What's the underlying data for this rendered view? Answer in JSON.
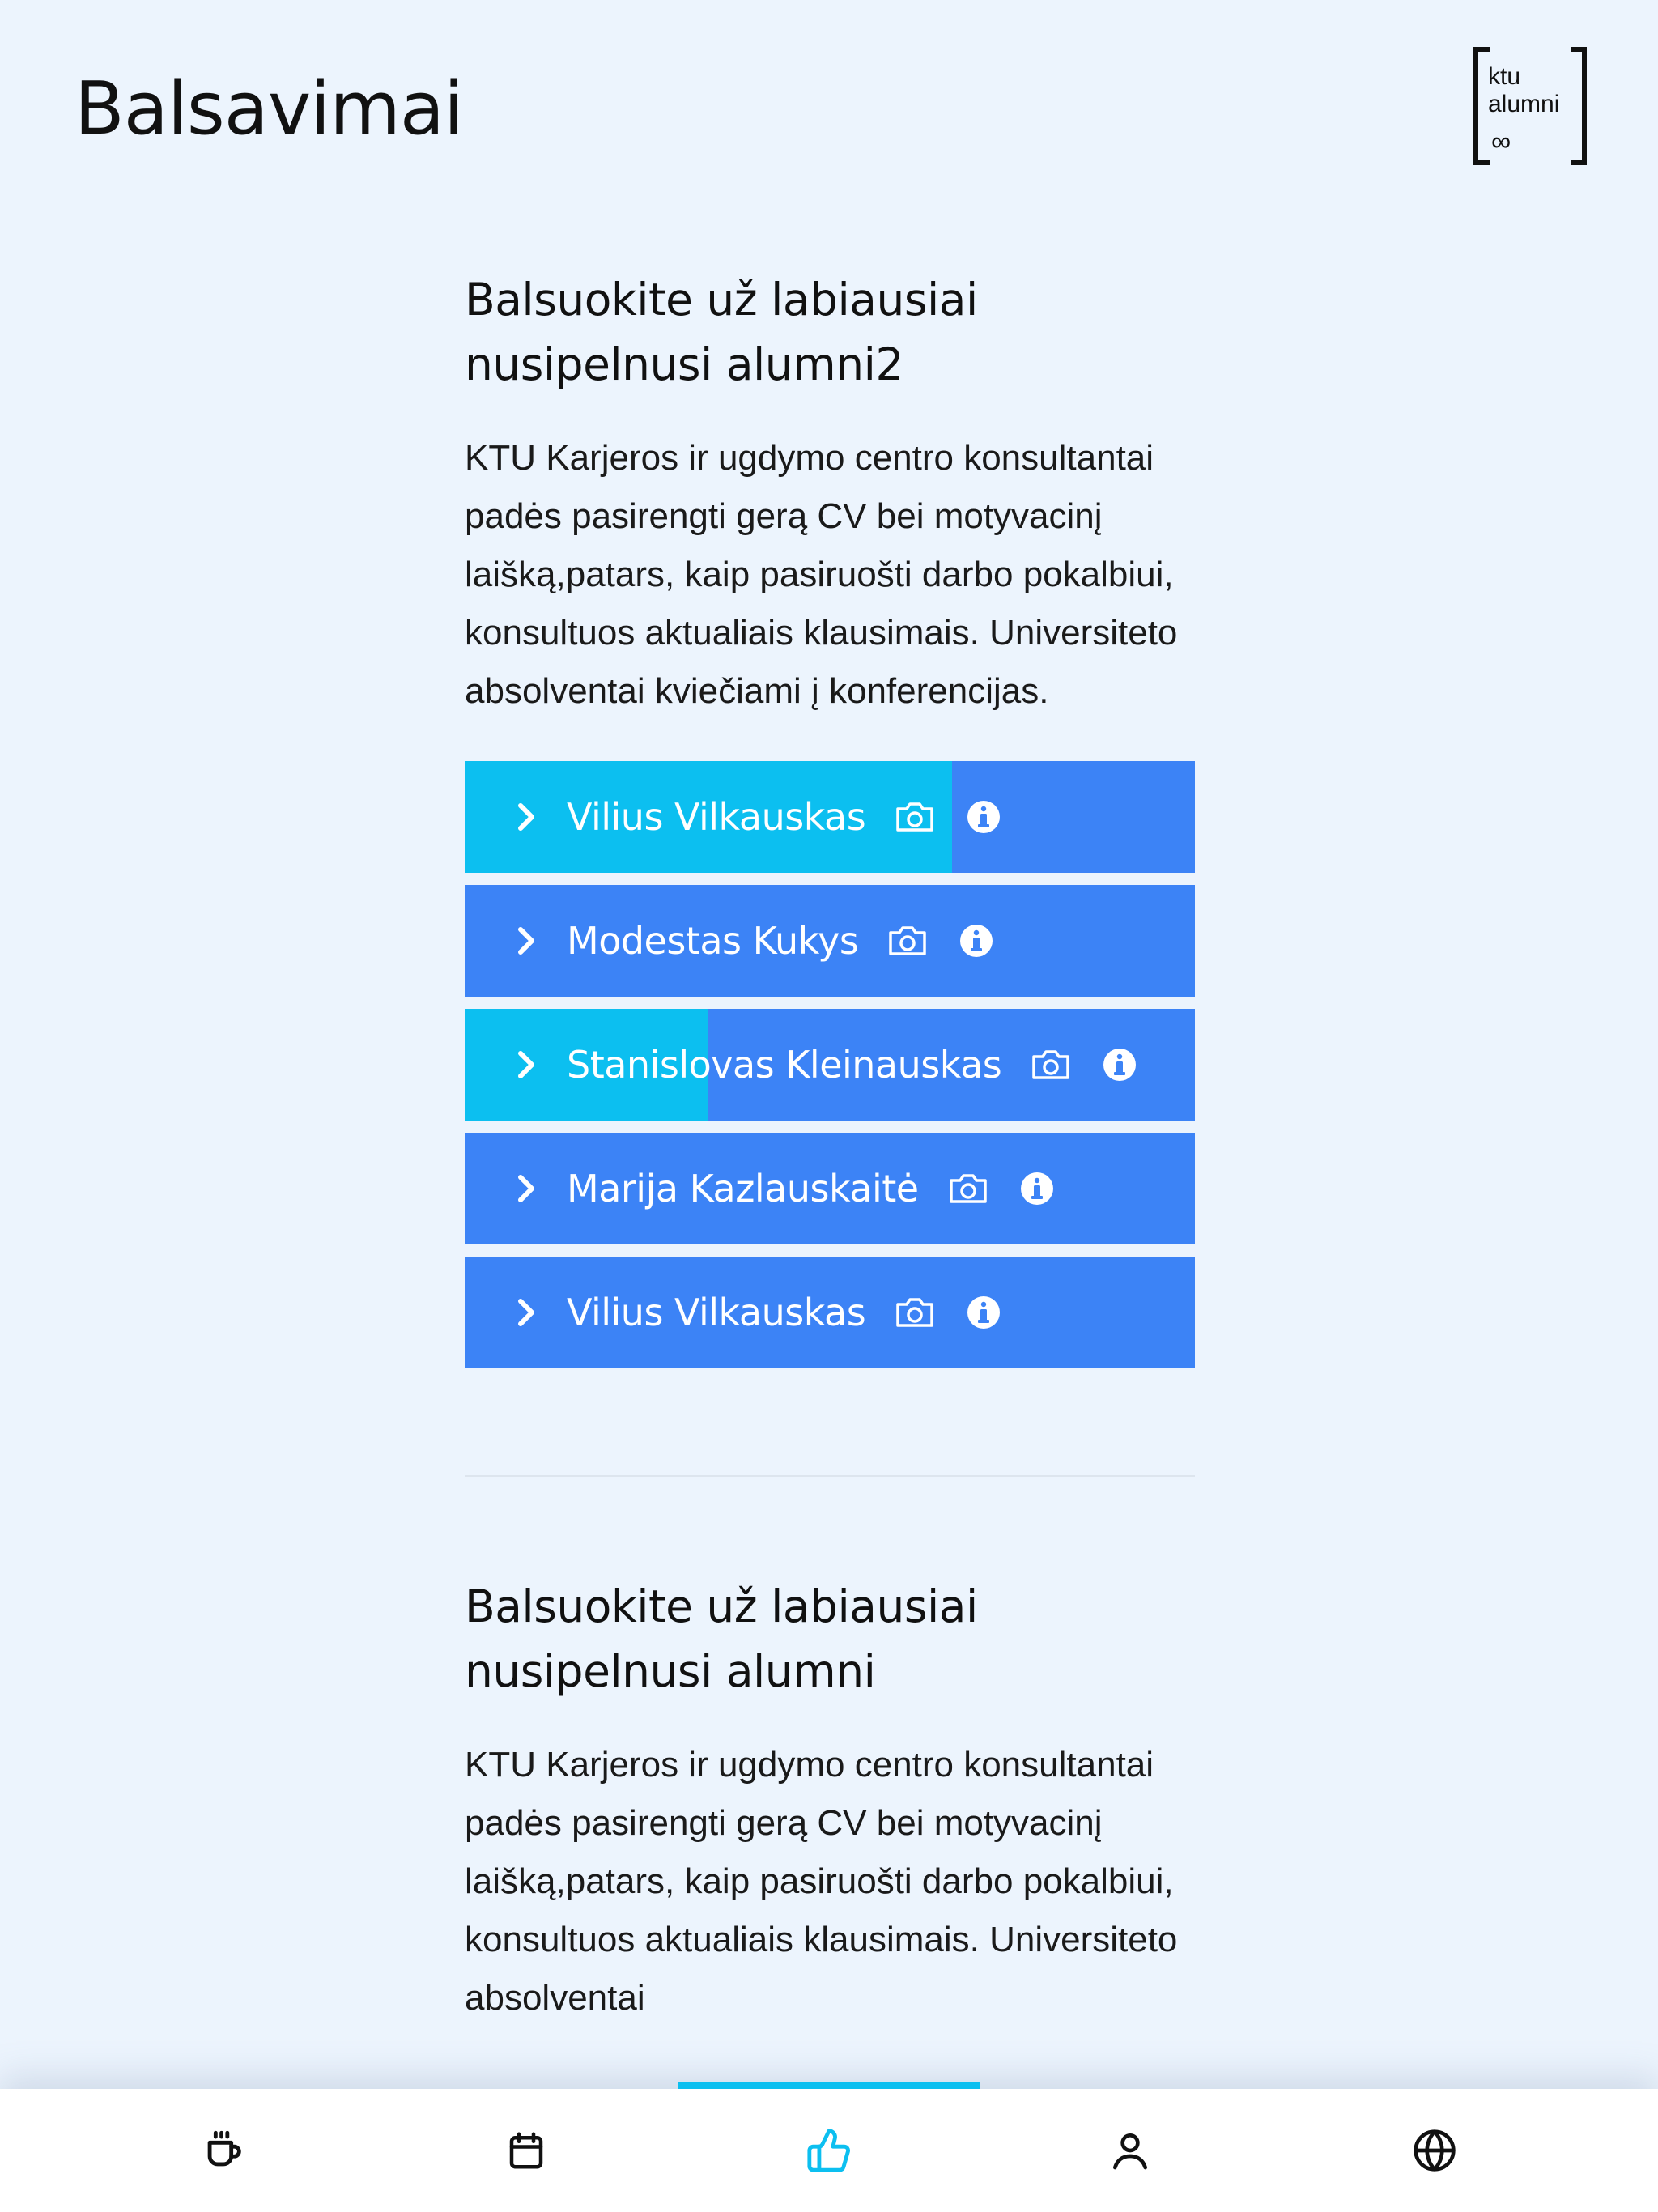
{
  "header": {
    "title": "Balsavimai",
    "logo_text": [
      "ktu",
      "alumni"
    ]
  },
  "sections": [
    {
      "title": "Balsuokite už labiausiai nusipelnusi alumni2",
      "description": "KTU Karjeros ir ugdymo centro konsultantai padės pasirengti gerą CV bei motyvacinį laišką,patars, kaip pasiruošti darbo pokalbiui, konsultuos aktualiais klausimais. Universiteto absolventai kviečiami į konferencijas.",
      "candidates": [
        {
          "name": "Vilius Vilkauskas",
          "vote_share": 0.667
        },
        {
          "name": "Modestas Kukys",
          "vote_share": 0
        },
        {
          "name": "Stanislovas Kleinauskas",
          "vote_share": 0.333
        },
        {
          "name": "Marija Kazlauskaitė",
          "vote_share": 0
        },
        {
          "name": "Vilius Vilkauskas",
          "vote_share": 0
        }
      ]
    },
    {
      "title": "Balsuokite už labiausiai nusipelnusi alumni",
      "description": "KTU Karjeros ir ugdymo centro konsultantai padės pasirengti gerą CV bei motyvacinį laišką,patars, kaip pasiruošti darbo pokalbiui, konsultuos aktualiais klausimais. Universiteto absolventai",
      "candidates": []
    }
  ],
  "bottom_nav": {
    "active": "votes",
    "items": [
      {
        "id": "news",
        "icon": "coffee-cup-icon"
      },
      {
        "id": "events",
        "icon": "calendar-icon"
      },
      {
        "id": "votes",
        "icon": "thumbs-up-icon"
      },
      {
        "id": "profile",
        "icon": "user-icon"
      },
      {
        "id": "language",
        "icon": "globe-icon"
      }
    ]
  },
  "colors": {
    "background": "#ecf4fd",
    "candidate_bar": "#3c83f6",
    "candidate_fill": "#0cbff0",
    "nav_active": "#0cbff0",
    "nav_icon": "#111111"
  }
}
